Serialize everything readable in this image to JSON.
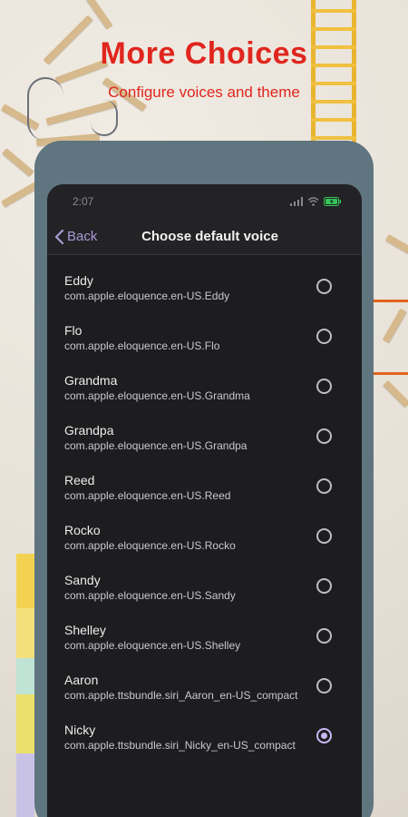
{
  "promo": {
    "headline": "More Choices",
    "subline": "Configure voices and theme"
  },
  "status_bar": {
    "time": "2:07"
  },
  "nav": {
    "back_label": "Back",
    "title": "Choose default voice"
  },
  "voices": [
    {
      "name": "Eddy",
      "id": "com.apple.eloquence.en-US.Eddy",
      "selected": false
    },
    {
      "name": "Flo",
      "id": "com.apple.eloquence.en-US.Flo",
      "selected": false
    },
    {
      "name": "Grandma",
      "id": "com.apple.eloquence.en-US.Grandma",
      "selected": false
    },
    {
      "name": "Grandpa",
      "id": "com.apple.eloquence.en-US.Grandpa",
      "selected": false
    },
    {
      "name": "Reed",
      "id": "com.apple.eloquence.en-US.Reed",
      "selected": false
    },
    {
      "name": "Rocko",
      "id": "com.apple.eloquence.en-US.Rocko",
      "selected": false
    },
    {
      "name": "Sandy",
      "id": "com.apple.eloquence.en-US.Sandy",
      "selected": false
    },
    {
      "name": "Shelley",
      "id": "com.apple.eloquence.en-US.Shelley",
      "selected": false
    },
    {
      "name": "Aaron",
      "id": "com.apple.ttsbundle.siri_Aaron_en-US_compact",
      "selected": false
    },
    {
      "name": "Nicky",
      "id": "com.apple.ttsbundle.siri_Nicky_en-US_compact",
      "selected": true
    }
  ],
  "colors": {
    "headline": "#e0261e",
    "accent": "#a99ad6",
    "screen_bg": "#1d1d1f",
    "frame": "#5f7580"
  }
}
